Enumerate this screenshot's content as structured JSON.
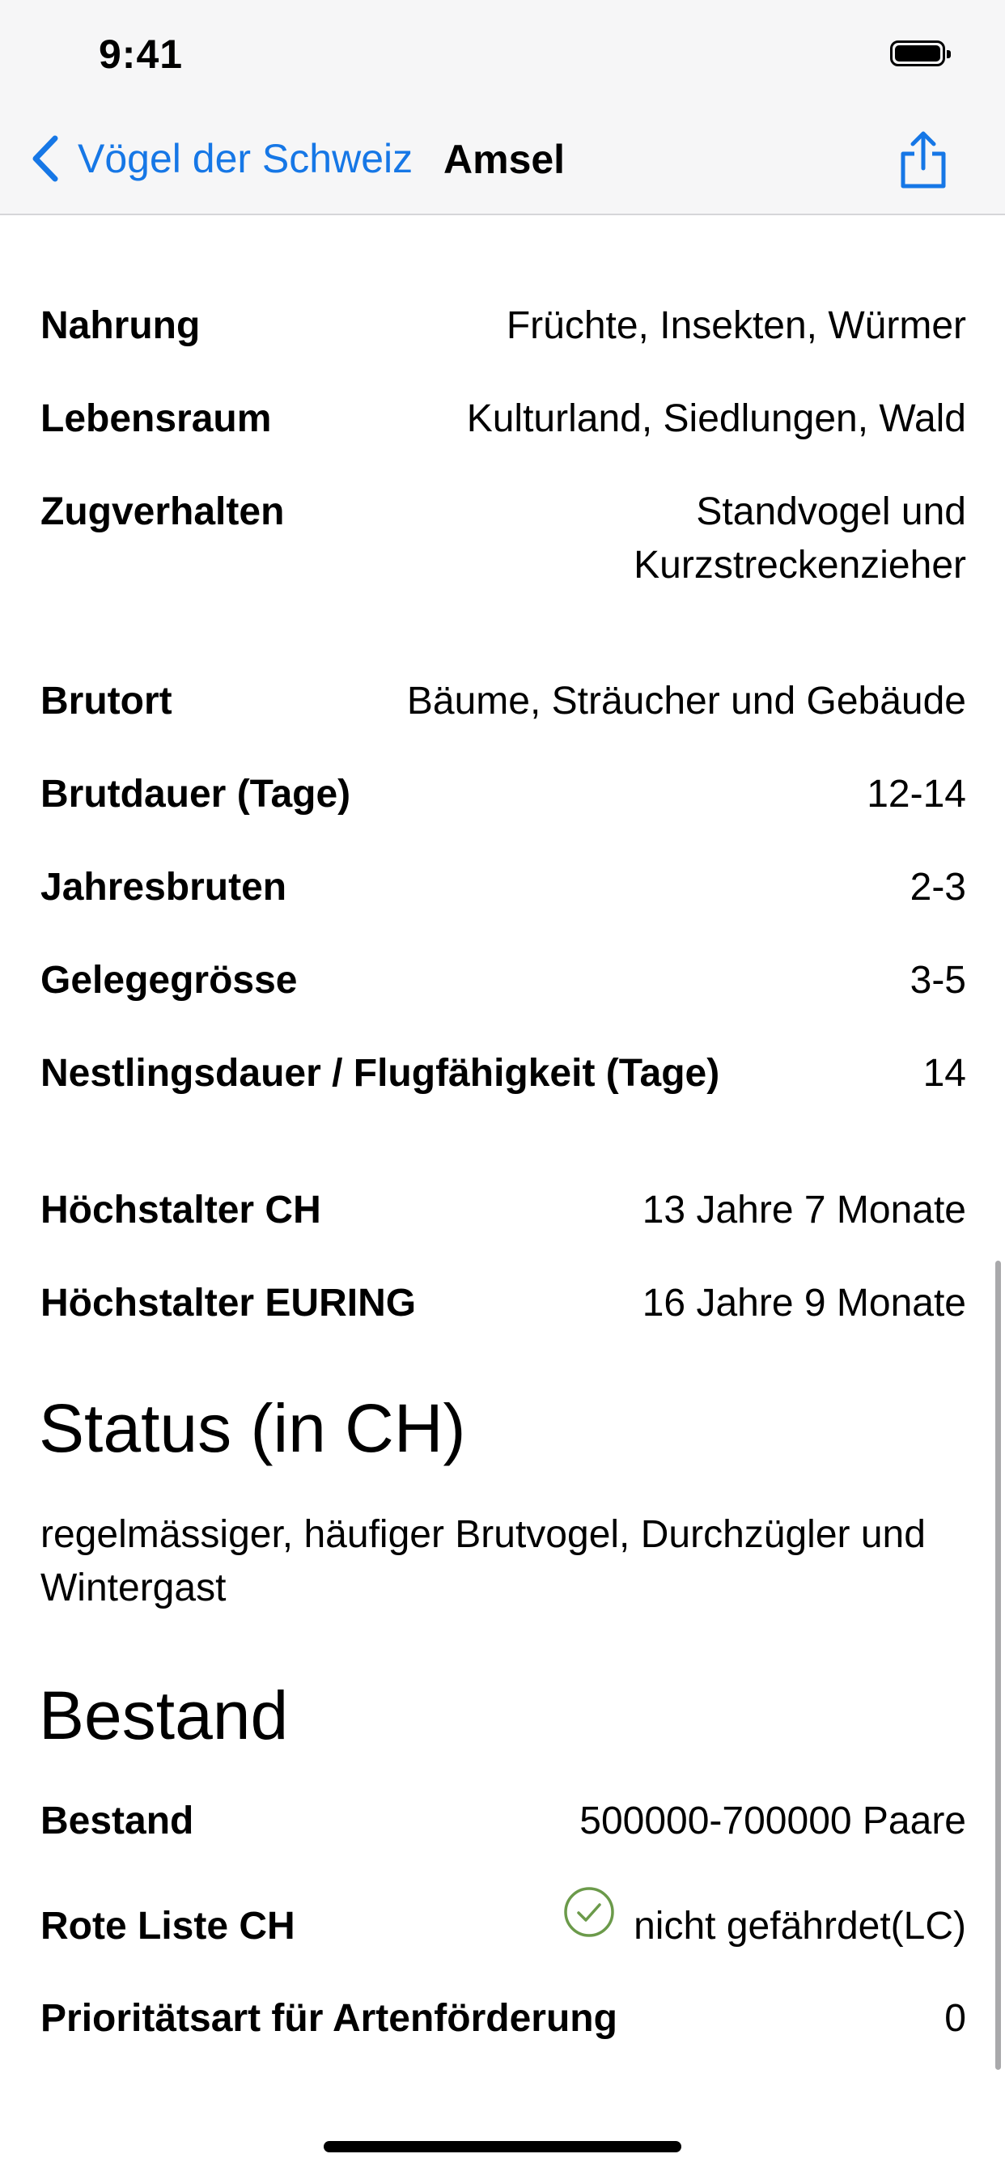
{
  "status_bar": {
    "time": "9:41"
  },
  "nav": {
    "back_label": "Vögel der Schweiz",
    "title": "Amsel"
  },
  "details": {
    "nahrung": {
      "label": "Nahrung",
      "value": "Früchte, Insekten, Würmer"
    },
    "lebensraum": {
      "label": "Lebensraum",
      "value": "Kulturland, Siedlungen, Wald"
    },
    "zugverhalten": {
      "label": "Zugverhalten",
      "value_line1": "Standvogel und",
      "value_line2": "Kurzstreckenzieher"
    },
    "brutort": {
      "label": "Brutort",
      "value": "Bäume, Sträucher und Gebäude"
    },
    "brutdauer": {
      "label": "Brutdauer (Tage)",
      "value": "12-14"
    },
    "jahresbruten": {
      "label": "Jahresbruten",
      "value": "2-3"
    },
    "gelegegroesse": {
      "label": "Gelegegrösse",
      "value": "3-5"
    },
    "nestlingsdauer": {
      "label": "Nestlingsdauer / Flugfähigkeit (Tage)",
      "value": "14"
    },
    "hoechstalter_ch": {
      "label": "Höchstalter CH",
      "value": "13 Jahre 7 Monate"
    },
    "hoechstalter_euring": {
      "label": "Höchstalter EURING",
      "value": "16 Jahre 9 Monate"
    }
  },
  "status_section": {
    "heading": "Status (in CH)",
    "text": "regelmässiger, häufiger Brutvogel, Durchzügler und Wintergast"
  },
  "bestand_section": {
    "heading": "Bestand",
    "bestand": {
      "label": "Bestand",
      "value": "500000-700000 Paare"
    },
    "rote_liste": {
      "label": "Rote Liste CH",
      "value": "nicht gefährdet(LC)",
      "icon": "check-circle-icon",
      "icon_color": "#6b9a4a"
    },
    "prioritaet": {
      "label": "Prioritätsart für Artenförderung",
      "value": "0"
    }
  },
  "colors": {
    "accent": "#1677e6",
    "bar_bg": "#f6f6f7"
  }
}
